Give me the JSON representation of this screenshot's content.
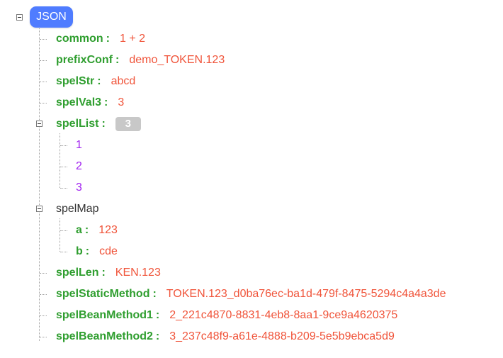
{
  "root": {
    "label": "JSON"
  },
  "nodes": {
    "common": {
      "key": "common",
      "value": "1 + 2"
    },
    "prefixConf": {
      "key": "prefixConf",
      "value": "demo_TOKEN.123"
    },
    "spelStr": {
      "key": "spelStr",
      "value": "abcd"
    },
    "spelVal3": {
      "key": "spelVal3",
      "value": "3"
    },
    "spelList": {
      "key": "spelList",
      "count": "3",
      "items": [
        "1",
        "2",
        "3"
      ]
    },
    "spelMap": {
      "key": "spelMap",
      "entries": {
        "a": {
          "key": "a",
          "value": "123"
        },
        "b": {
          "key": "b",
          "value": "cde"
        }
      }
    },
    "spelLen": {
      "key": "spelLen",
      "value": "KEN.123"
    },
    "spelStaticMethod": {
      "key": "spelStaticMethod",
      "value": "TOKEN.123_d0ba76ec-ba1d-479f-8475-5294c4a4a3de"
    },
    "spelBeanMethod1": {
      "key": "spelBeanMethod1",
      "value": "2_221c4870-8831-4eb8-8aa1-9ce9a4620375"
    },
    "spelBeanMethod2": {
      "key": "spelBeanMethod2",
      "value": "3_237c48f9-a61e-4888-b209-5e5b9ebca5d9"
    }
  },
  "labels": {
    "colon": ":"
  },
  "colors": {
    "key": "#2f9e2f",
    "string_value": "#f0543a",
    "array_index_value": "#a020f0",
    "root_badge": "#4f7cff",
    "count_badge": "#c8c8c8"
  }
}
